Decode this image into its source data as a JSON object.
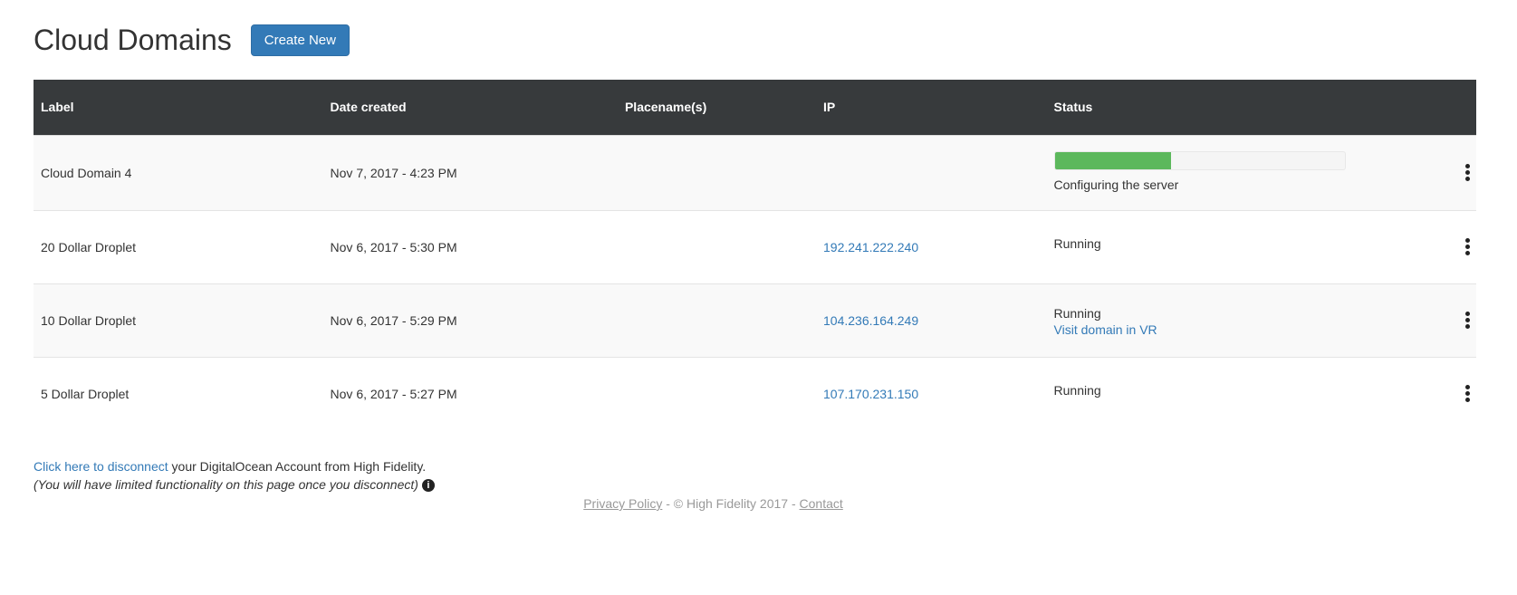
{
  "header": {
    "title": "Cloud Domains",
    "create_label": "Create New"
  },
  "table": {
    "columns": [
      "Label",
      "Date created",
      "Placename(s)",
      "IP",
      "Status"
    ],
    "rows": [
      {
        "label": "Cloud Domain 4",
        "date": "Nov 7, 2017 - 4:23 PM",
        "placenames": "",
        "ip": "",
        "status": "Configuring the server",
        "progress_fraction": 0.4
      },
      {
        "label": "20 Dollar Droplet",
        "date": "Nov 6, 2017 - 5:30 PM",
        "placenames": "",
        "ip": "192.241.222.240",
        "status": "Running"
      },
      {
        "label": "10 Dollar Droplet",
        "date": "Nov 6, 2017 - 5:29 PM",
        "placenames": "",
        "ip": "104.236.164.249",
        "status": "Running",
        "status_link": "Visit domain in VR"
      },
      {
        "label": "5 Dollar Droplet",
        "date": "Nov 6, 2017 - 5:27 PM",
        "placenames": "",
        "ip": "107.170.231.150",
        "status": "Running"
      }
    ]
  },
  "disconnect": {
    "link": "Click here to disconnect",
    "text": " your DigitalOcean Account from High Fidelity.",
    "note": "(You will have limited functionality on this page once you disconnect)",
    "info_icon": "info-icon"
  },
  "footer": {
    "privacy": "Privacy Policy",
    "separator1": " - ",
    "copyright": "© High Fidelity 2017",
    "separator2": " - ",
    "contact": "Contact"
  },
  "colors": {
    "primary": "#337ab7",
    "header_bg": "#373a3c",
    "progress": "#5cb85c"
  }
}
